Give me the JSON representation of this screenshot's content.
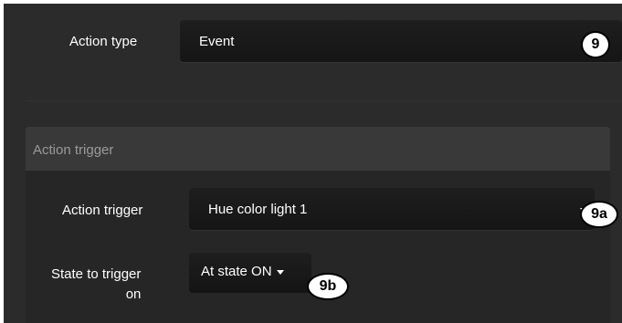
{
  "action_type": {
    "label": "Action type",
    "value": "Event",
    "callout": "9"
  },
  "action_trigger_section": {
    "title": "Action trigger",
    "trigger_label": "Action trigger",
    "trigger_value": "Hue color light 1",
    "trigger_callout": "9a",
    "state_label_line1": "State to trigger",
    "state_label_line2": "on",
    "state_value": "At state ON",
    "state_callout": "9b"
  }
}
